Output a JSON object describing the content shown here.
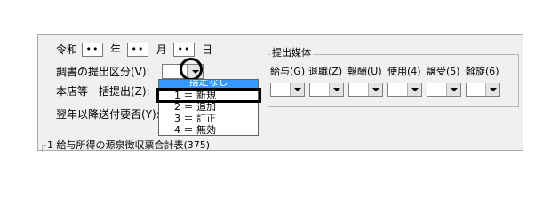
{
  "date": {
    "era_label": "令和",
    "year_value": "••",
    "year_label": "年",
    "month_value": "••",
    "month_label": "月",
    "day_value": "••",
    "day_label": "日"
  },
  "fields": {
    "submission_type_label": "調書の提出区分(V):",
    "head_office_label": "本店等一括提出(Z):",
    "next_year_label": "翌年以降送付要否(Y):"
  },
  "dropdown": {
    "highlighted": "指定なし",
    "options": [
      "1 ＝ 新規",
      "2 ＝ 追加",
      "3 ＝ 訂正",
      "4 ＝ 無効"
    ]
  },
  "media": {
    "title": "提出媒体",
    "columns": [
      "給与(G)",
      "退職(Z)",
      "報酬(U)",
      "使用(4)",
      "譲受(5)",
      "斡旋(6)"
    ]
  },
  "section": {
    "title": "1 給与所得の源泉徴収票合計表(375)"
  }
}
